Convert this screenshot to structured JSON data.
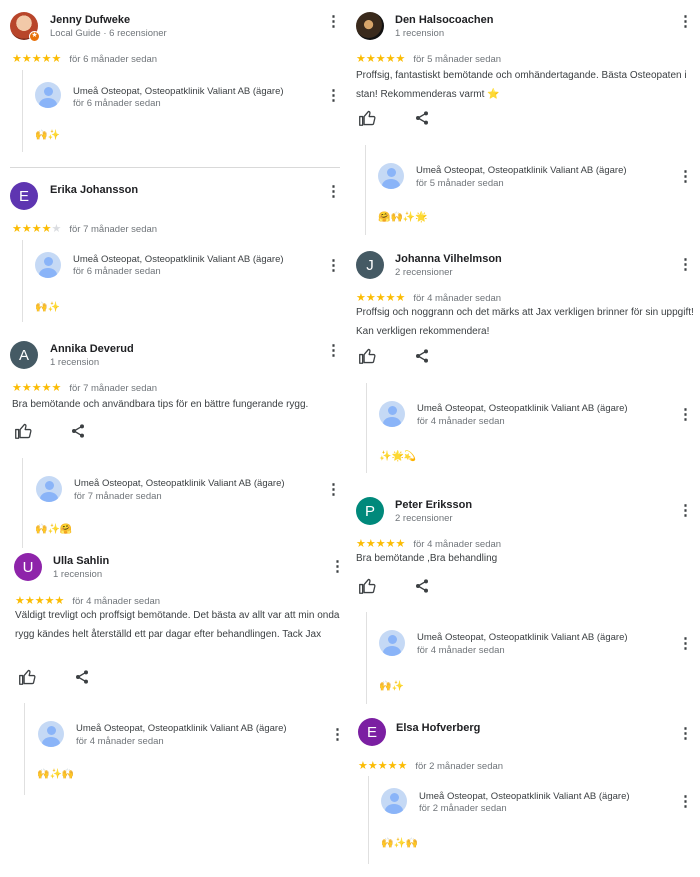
{
  "colors": {
    "star": "#fbbc04",
    "avatar_purple": "#5e35b1",
    "avatar_slate": "#455a64",
    "avatar_magenta": "#8e24aa",
    "avatar_teal": "#00897b",
    "avatar_violet": "#7b1fa2"
  },
  "owner_name": "Umeå Osteopat, Osteopatklinik Valiant AB (ägare)",
  "left": [
    {
      "name": "Jenny Dufweke",
      "sub": "Local Guide · 6 recensioner",
      "stars": 5,
      "date": "för 6 månader sedan",
      "text": "",
      "reply_date": "för 6 månader sedan",
      "reply_emoji": "🙌✨"
    },
    {
      "name": "Erika Johansson",
      "initial": "E",
      "sub": "",
      "stars": 4,
      "date": "för 7 månader sedan",
      "text": "",
      "reply_date": "för 6 månader sedan",
      "reply_emoji": "🙌✨"
    },
    {
      "name": "Annika Deverud",
      "initial": "A",
      "sub": "1 recension",
      "stars": 5,
      "date": "för 7 månader sedan",
      "text": "Bra bemötande och användbara tips för en bättre fungerande rygg.",
      "reply_date": "för 7 månader sedan",
      "reply_emoji": "🙌✨🤗"
    },
    {
      "name": "Ulla Sahlin",
      "initial": "U",
      "sub": "1 recension",
      "stars": 5,
      "date": "för 4 månader sedan",
      "text": "Väldigt trevligt och proffsigt bemötande. Det bästa av allt var att min onda rygg kändes helt återställd ett par dagar efter behandlingen. Tack Jax",
      "reply_date": "för 4 månader sedan",
      "reply_emoji": "🙌✨🙌"
    }
  ],
  "right": [
    {
      "name": "Den Halsocoachen",
      "sub": "1 recension",
      "stars": 5,
      "date": "för 5 månader sedan",
      "text": "Proffsig, fantastiskt bemötande och omhändertagande. Bästa Osteopaten i stan! Rekommenderas varmt ⭐",
      "reply_date": "för 5 månader sedan",
      "reply_emoji": "🤗🙌✨🌟"
    },
    {
      "name": "Johanna Vilhelmson",
      "initial": "J",
      "sub": "2 recensioner",
      "stars": 5,
      "date": "för 4 månader sedan",
      "text": "Proffsig och noggrann och det märks att Jax verkligen brinner för sin uppgift! Kan verkligen rekommendera!",
      "reply_date": "för 4 månader sedan",
      "reply_emoji": "✨🌟💫"
    },
    {
      "name": "Peter Eriksson",
      "initial": "P",
      "sub": "2 recensioner",
      "stars": 5,
      "date": "för 4 månader sedan",
      "text": "Bra bemötande ,Bra behandling",
      "reply_date": "för 4 månader sedan",
      "reply_emoji": "🙌✨"
    },
    {
      "name": "Elsa Hofverberg",
      "initial": "E",
      "sub": "",
      "stars": 5,
      "date": "för 2 månader sedan",
      "text": "",
      "reply_date": "för 2 månader sedan",
      "reply_emoji": "🙌✨🙌"
    }
  ]
}
